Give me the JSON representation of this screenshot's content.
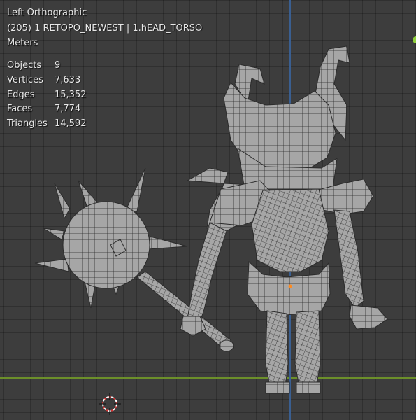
{
  "viewport": {
    "view_name": "Left Orthographic",
    "collection_line": "(205) 1 RETOPO_NEWEST | 1.hEAD_TORSO",
    "units": "Meters"
  },
  "stats": [
    {
      "label": "Objects",
      "value": "9"
    },
    {
      "label": "Vertices",
      "value": "7,633"
    },
    {
      "label": "Edges",
      "value": "15,352"
    },
    {
      "label": "Faces",
      "value": "7,774"
    },
    {
      "label": "Triangles",
      "value": "14,592"
    }
  ],
  "colors": {
    "background": "#3d3d3d",
    "x_axis": "#6c8f2a",
    "z_axis": "#3a5f91",
    "mesh_fill": "#a9a9a9",
    "wire": "#2a2a2a"
  }
}
